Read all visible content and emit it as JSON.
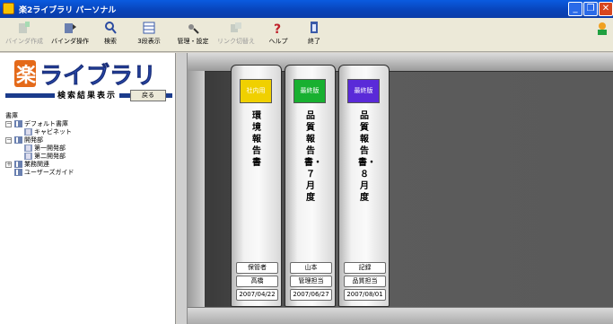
{
  "window": {
    "title": "楽2ライブラリ パーソナル"
  },
  "toolbar": {
    "items": [
      {
        "label": "バインダ作成",
        "icon": "binder-create-icon",
        "enabled": false
      },
      {
        "label": "バインダ操作",
        "icon": "binder-operate-icon",
        "enabled": true
      },
      {
        "label": "検索",
        "icon": "search-icon",
        "enabled": true
      },
      {
        "label": "3段表示",
        "icon": "three-tier-view-icon",
        "enabled": true
      },
      {
        "label": "管理・設定",
        "icon": "admin-settings-icon",
        "enabled": true
      },
      {
        "label": "リンク切替え",
        "icon": "link-switch-icon",
        "enabled": false
      },
      {
        "label": "ヘルプ",
        "icon": "help-icon",
        "enabled": true
      },
      {
        "label": "終了",
        "icon": "exit-icon",
        "enabled": true
      }
    ]
  },
  "sidebar": {
    "logo_text": "楽ライブラリ",
    "search_caption": "検索結果表示",
    "back_label": "戻る",
    "tree": [
      {
        "label": "書庫",
        "level": 0,
        "expander": "",
        "icon": false
      },
      {
        "label": "デフォルト書庫",
        "level": 1,
        "expander": "－",
        "icon": true
      },
      {
        "label": "キャビネット",
        "level": 2,
        "expander": "",
        "icon": true
      },
      {
        "label": "開発部",
        "level": 1,
        "expander": "－",
        "icon": true
      },
      {
        "label": "第一開発部",
        "level": 2,
        "expander": "",
        "icon": true
      },
      {
        "label": "第二開発部",
        "level": 2,
        "expander": "",
        "icon": true
      },
      {
        "label": "業務関連",
        "level": 1,
        "expander": "＋",
        "icon": true
      },
      {
        "label": "ユーザーズガイド",
        "level": 1,
        "expander": "",
        "icon": true
      }
    ]
  },
  "binders": [
    {
      "tag": "社内用",
      "tag_color": "#f0d000",
      "title": "環境報告書",
      "role": "保管者",
      "person": "高橋",
      "date": "2007/04/22"
    },
    {
      "tag": "最終版",
      "tag_color": "#18b030",
      "title": "品質報告書・７月度",
      "role": "山本",
      "person": "管理担当",
      "date": "2007/06/27"
    },
    {
      "tag": "最終版",
      "tag_color": "#5a2ad8",
      "title": "品質報告書・８月度",
      "role": "記録",
      "person": "品質担当",
      "date": "2007/08/01"
    }
  ]
}
